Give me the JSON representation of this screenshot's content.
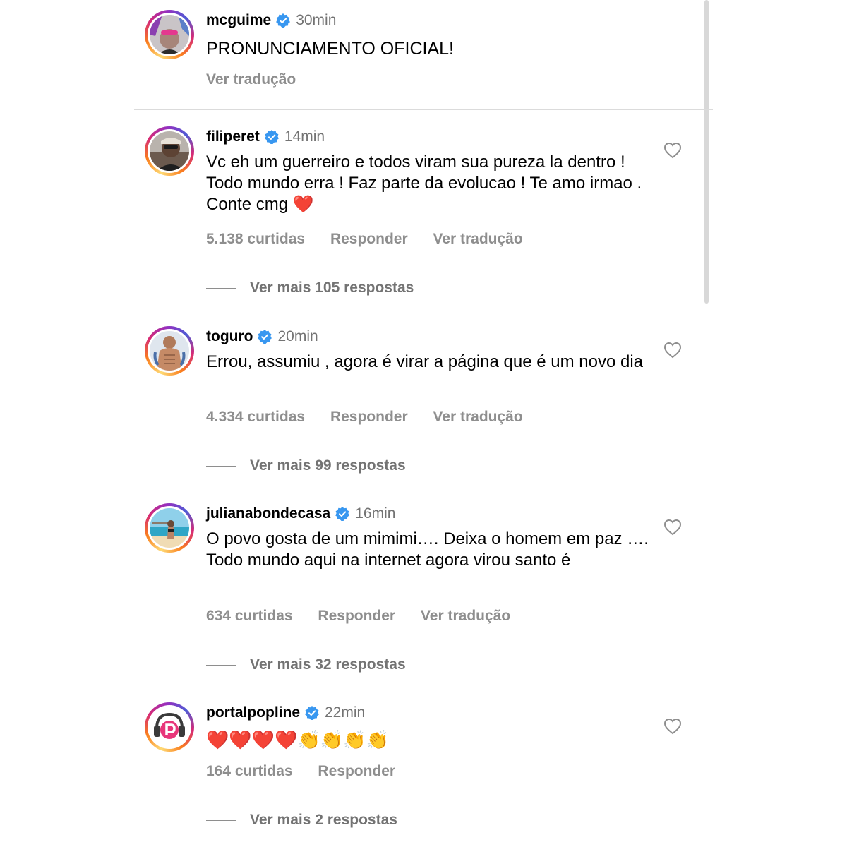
{
  "post": {
    "username": "mcguime",
    "time": "30min",
    "caption": "PRONUNCIAMENTO OFICIAL!",
    "translate": "Ver tradução"
  },
  "comments": [
    {
      "username": "filiperet",
      "time": "14min",
      "text": "Vc eh um guerreiro e todos viram sua pureza la dentro ! Todo mundo erra ! Faz parte da evolucao ! Te amo irmao . Conte cmg ❤️",
      "likes": "5.138 curtidas",
      "reply": "Responder",
      "translate": "Ver tradução",
      "more_replies": "Ver mais 105 respostas"
    },
    {
      "username": "toguro",
      "time": "20min",
      "text": "Errou, assumiu , agora é virar a página que é um novo dia",
      "likes": "4.334 curtidas",
      "reply": "Responder",
      "translate": "Ver tradução",
      "more_replies": "Ver mais 99 respostas"
    },
    {
      "username": "julianabondecasa",
      "time": "16min",
      "text": "O  povo gosta de um mimimi…. Deixa o homem em paz …. Todo mundo aqui na internet agora virou santo é",
      "likes": "634 curtidas",
      "reply": "Responder",
      "translate": "Ver tradução",
      "more_replies": "Ver mais 32 respostas"
    },
    {
      "username": "portalpopline",
      "time": "22min",
      "text": "❤️❤️❤️❤️👏👏👏👏",
      "likes": "164 curtidas",
      "reply": "Responder",
      "more_replies": "Ver mais 2 respostas"
    }
  ],
  "icons": {
    "verified": "verified-badge-icon",
    "like": "heart-outline-icon"
  },
  "colors": {
    "verified_blue": "#3897f0",
    "muted_text": "#8e8e8e",
    "heart_red": "#e0102b"
  }
}
